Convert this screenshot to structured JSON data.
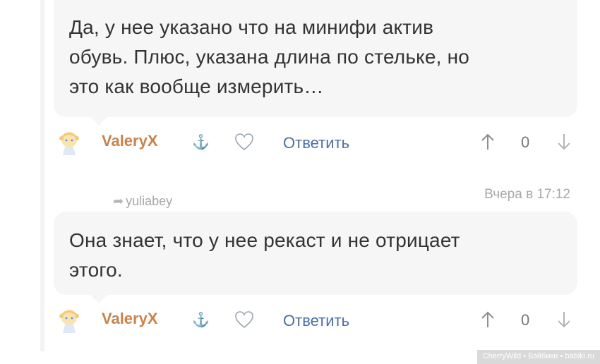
{
  "comments": [
    {
      "text_lines": [
        "Да, у нее указано что на минифи актив",
        "обувь. Плюс, указана длина по стельке, но",
        "это как вообще измерить…"
      ],
      "author": "ValeryX",
      "reply_label": "Ответить",
      "vote_count": "0"
    },
    {
      "reply_to": "yuliabey",
      "timestamp": "Вчера в 17:12",
      "text_lines": [
        "Она знает, что у нее рекаст и не отрицает",
        "этого."
      ],
      "author": "ValeryX",
      "reply_label": "Ответить",
      "vote_count": "0"
    }
  ],
  "icons": {
    "anchor": "anchor-icon",
    "heart": "heart-icon",
    "up": "arrow-up-icon",
    "down": "arrow-down-icon",
    "reply_to": "reply-arrow-icon"
  },
  "colors": {
    "author": "#c9834a",
    "link": "#4b6fa5",
    "bubble": "#f6f6f6"
  },
  "watermark": "CherryWild • Бэйбики • babiki.ru"
}
